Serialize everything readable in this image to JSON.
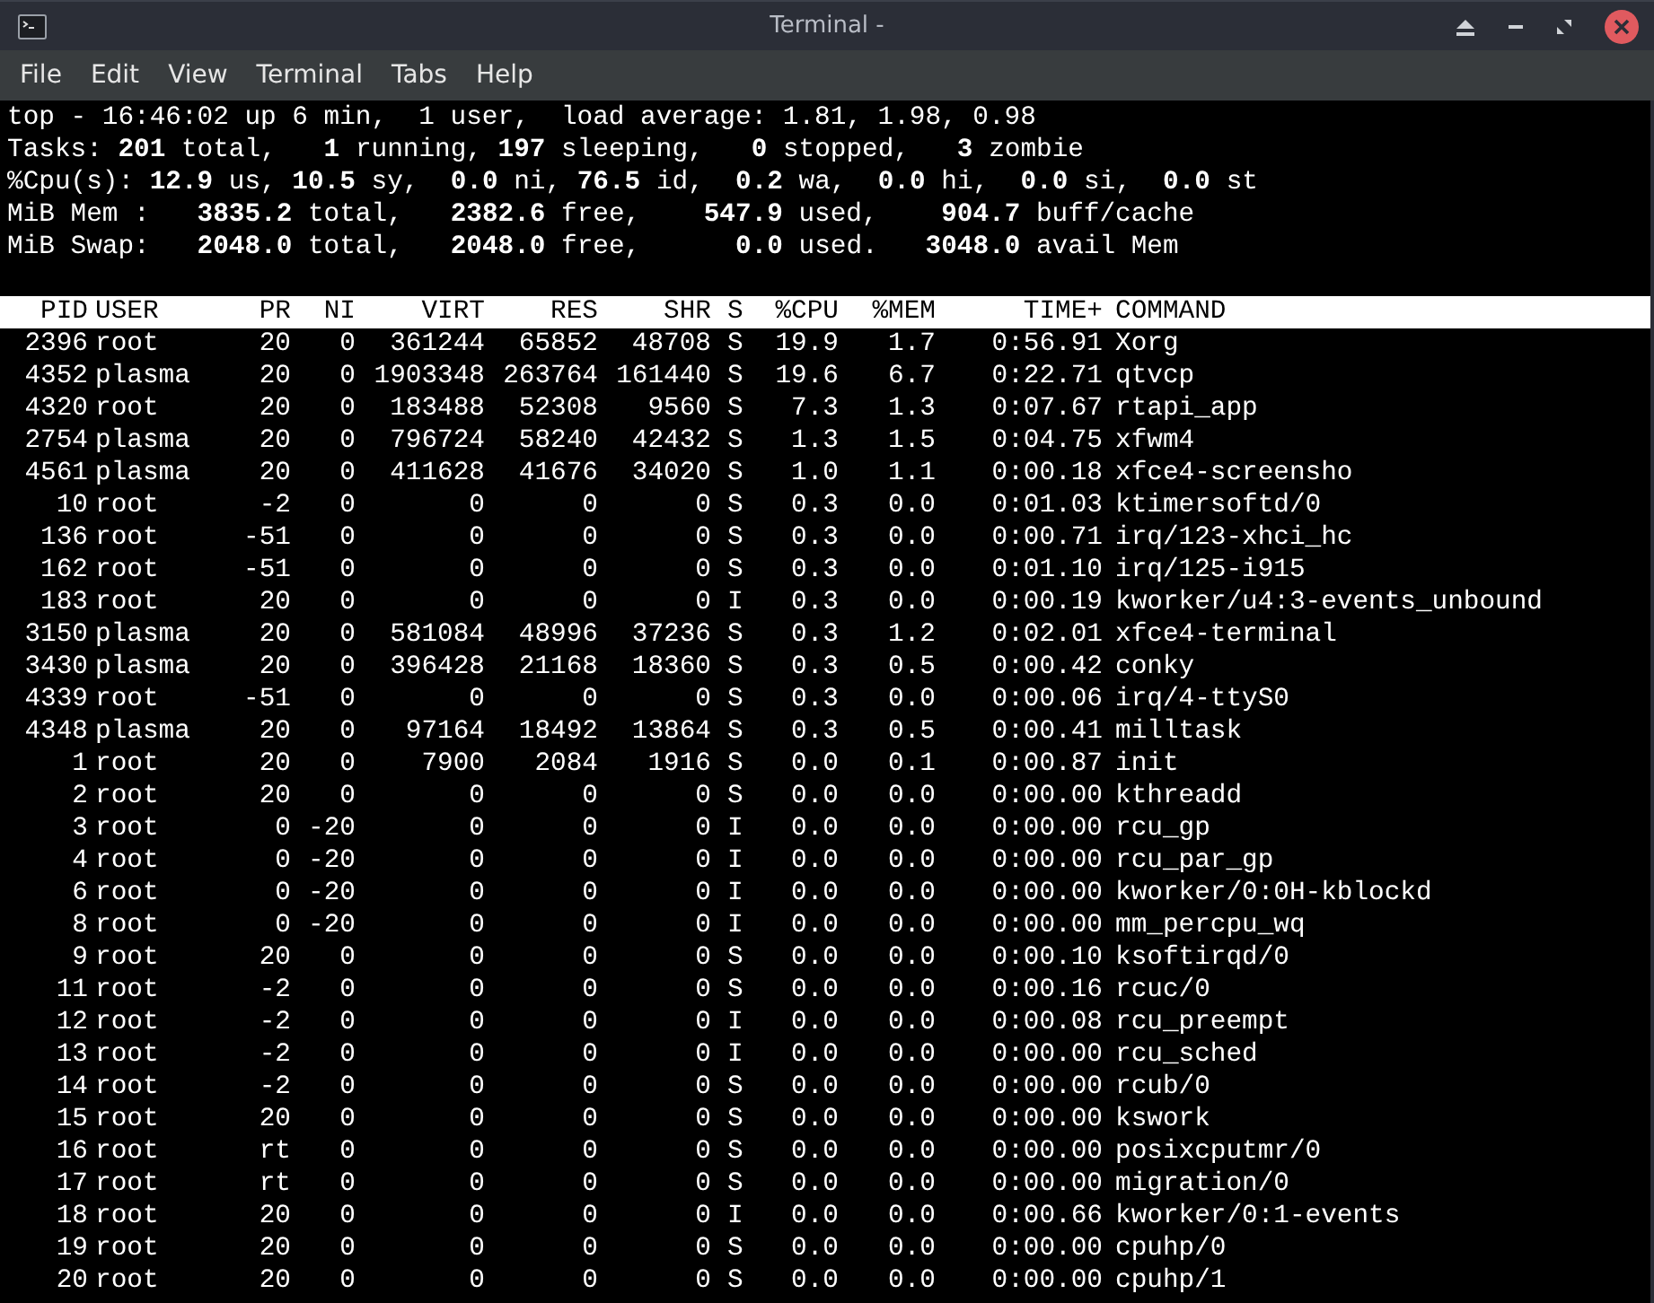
{
  "window": {
    "title": "Terminal -"
  },
  "menu": [
    "File",
    "Edit",
    "View",
    "Terminal",
    "Tabs",
    "Help"
  ],
  "summary": [
    "top - 16:46:02 up 6 min,  1 user,  load average: 1.81, 1.98, 0.98",
    "Tasks: **201** total,   **1** running, **197** sleeping,   **0** stopped,   **3** zombie",
    "%Cpu(s): **12.9** us, **10.5** sy,  **0.0** ni, **76.5** id,  **0.2** wa,  **0.0** hi,  **0.0** si,  **0.0** st",
    "MiB Mem :   **3835.2** total,   **2382.6** free,    **547.9** used,    **904.7** buff/cache",
    "MiB Swap:   **2048.0** total,   **2048.0** free,      **0.0** used.   **3048.0** avail Mem"
  ],
  "table": {
    "columns": [
      "PID",
      "USER",
      "PR",
      "NI",
      "VIRT",
      "RES",
      "SHR",
      "S",
      "%CPU",
      "%MEM",
      "TIME+",
      "COMMAND"
    ],
    "rows": [
      [
        "2396",
        "root",
        "20",
        "0",
        "361244",
        "65852",
        "48708",
        "S",
        "19.9",
        "1.7",
        "0:56.91",
        "Xorg"
      ],
      [
        "4352",
        "plasma",
        "20",
        "0",
        "1903348",
        "263764",
        "161440",
        "S",
        "19.6",
        "6.7",
        "0:22.71",
        "qtvcp"
      ],
      [
        "4320",
        "root",
        "20",
        "0",
        "183488",
        "52308",
        "9560",
        "S",
        "7.3",
        "1.3",
        "0:07.67",
        "rtapi_app"
      ],
      [
        "2754",
        "plasma",
        "20",
        "0",
        "796724",
        "58240",
        "42432",
        "S",
        "1.3",
        "1.5",
        "0:04.75",
        "xfwm4"
      ],
      [
        "4561",
        "plasma",
        "20",
        "0",
        "411628",
        "41676",
        "34020",
        "S",
        "1.0",
        "1.1",
        "0:00.18",
        "xfce4-screensho"
      ],
      [
        "10",
        "root",
        "-2",
        "0",
        "0",
        "0",
        "0",
        "S",
        "0.3",
        "0.0",
        "0:01.03",
        "ktimersoftd/0"
      ],
      [
        "136",
        "root",
        "-51",
        "0",
        "0",
        "0",
        "0",
        "S",
        "0.3",
        "0.0",
        "0:00.71",
        "irq/123-xhci_hc"
      ],
      [
        "162",
        "root",
        "-51",
        "0",
        "0",
        "0",
        "0",
        "S",
        "0.3",
        "0.0",
        "0:01.10",
        "irq/125-i915"
      ],
      [
        "183",
        "root",
        "20",
        "0",
        "0",
        "0",
        "0",
        "I",
        "0.3",
        "0.0",
        "0:00.19",
        "kworker/u4:3-events_unbound"
      ],
      [
        "3150",
        "plasma",
        "20",
        "0",
        "581084",
        "48996",
        "37236",
        "S",
        "0.3",
        "1.2",
        "0:02.01",
        "xfce4-terminal"
      ],
      [
        "3430",
        "plasma",
        "20",
        "0",
        "396428",
        "21168",
        "18360",
        "S",
        "0.3",
        "0.5",
        "0:00.42",
        "conky"
      ],
      [
        "4339",
        "root",
        "-51",
        "0",
        "0",
        "0",
        "0",
        "S",
        "0.3",
        "0.0",
        "0:00.06",
        "irq/4-ttyS0"
      ],
      [
        "4348",
        "plasma",
        "20",
        "0",
        "97164",
        "18492",
        "13864",
        "S",
        "0.3",
        "0.5",
        "0:00.41",
        "milltask"
      ],
      [
        "1",
        "root",
        "20",
        "0",
        "7900",
        "2084",
        "1916",
        "S",
        "0.0",
        "0.1",
        "0:00.87",
        "init"
      ],
      [
        "2",
        "root",
        "20",
        "0",
        "0",
        "0",
        "0",
        "S",
        "0.0",
        "0.0",
        "0:00.00",
        "kthreadd"
      ],
      [
        "3",
        "root",
        "0",
        "-20",
        "0",
        "0",
        "0",
        "I",
        "0.0",
        "0.0",
        "0:00.00",
        "rcu_gp"
      ],
      [
        "4",
        "root",
        "0",
        "-20",
        "0",
        "0",
        "0",
        "I",
        "0.0",
        "0.0",
        "0:00.00",
        "rcu_par_gp"
      ],
      [
        "6",
        "root",
        "0",
        "-20",
        "0",
        "0",
        "0",
        "I",
        "0.0",
        "0.0",
        "0:00.00",
        "kworker/0:0H-kblockd"
      ],
      [
        "8",
        "root",
        "0",
        "-20",
        "0",
        "0",
        "0",
        "I",
        "0.0",
        "0.0",
        "0:00.00",
        "mm_percpu_wq"
      ],
      [
        "9",
        "root",
        "20",
        "0",
        "0",
        "0",
        "0",
        "S",
        "0.0",
        "0.0",
        "0:00.10",
        "ksoftirqd/0"
      ],
      [
        "11",
        "root",
        "-2",
        "0",
        "0",
        "0",
        "0",
        "S",
        "0.0",
        "0.0",
        "0:00.16",
        "rcuc/0"
      ],
      [
        "12",
        "root",
        "-2",
        "0",
        "0",
        "0",
        "0",
        "I",
        "0.0",
        "0.0",
        "0:00.08",
        "rcu_preempt"
      ],
      [
        "13",
        "root",
        "-2",
        "0",
        "0",
        "0",
        "0",
        "I",
        "0.0",
        "0.0",
        "0:00.00",
        "rcu_sched"
      ],
      [
        "14",
        "root",
        "-2",
        "0",
        "0",
        "0",
        "0",
        "S",
        "0.0",
        "0.0",
        "0:00.00",
        "rcub/0"
      ],
      [
        "15",
        "root",
        "20",
        "0",
        "0",
        "0",
        "0",
        "S",
        "0.0",
        "0.0",
        "0:00.00",
        "kswork"
      ],
      [
        "16",
        "root",
        "rt",
        "0",
        "0",
        "0",
        "0",
        "S",
        "0.0",
        "0.0",
        "0:00.00",
        "posixcputmr/0"
      ],
      [
        "17",
        "root",
        "rt",
        "0",
        "0",
        "0",
        "0",
        "S",
        "0.0",
        "0.0",
        "0:00.00",
        "migration/0"
      ],
      [
        "18",
        "root",
        "20",
        "0",
        "0",
        "0",
        "0",
        "I",
        "0.0",
        "0.0",
        "0:00.66",
        "kworker/0:1-events"
      ],
      [
        "19",
        "root",
        "20",
        "0",
        "0",
        "0",
        "0",
        "S",
        "0.0",
        "0.0",
        "0:00.00",
        "cpuhp/0"
      ],
      [
        "20",
        "root",
        "20",
        "0",
        "0",
        "0",
        "0",
        "S",
        "0.0",
        "0.0",
        "0:00.00",
        "cpuhp/1"
      ]
    ]
  }
}
